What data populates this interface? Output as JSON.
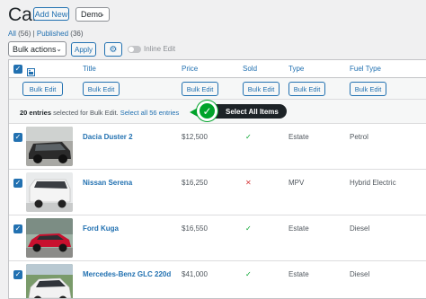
{
  "header": {
    "title": "Cars",
    "add_new": "Add New",
    "view_select": "Demo"
  },
  "subsubsub": {
    "all": "All",
    "all_count": "(56)",
    "sep": "|",
    "published": "Published",
    "published_count": "(36)"
  },
  "toolbar": {
    "bulk_actions": "Bulk actions",
    "apply": "Apply",
    "inline_edit": "Inline Edit"
  },
  "columns": [
    "Title",
    "Price",
    "Sold",
    "Type",
    "Fuel Type"
  ],
  "bulk_edit_label": "Bulk Edit",
  "selection": {
    "count_text": "20 entries",
    "rest_text": " selected for Bulk Edit.",
    "select_all_link": "Select all 56 entries",
    "callout": "Select All Items"
  },
  "rows": [
    {
      "title": "Dacia Duster 2",
      "price": "$12,500",
      "sold": "✓",
      "sold_state": "yes",
      "type": "Estate",
      "fuel": "Petrol",
      "car_color": "#2b2b2b"
    },
    {
      "title": "Nissan Serena",
      "price": "$16,250",
      "sold": "✕",
      "sold_state": "no",
      "type": "MPV",
      "fuel": "Hybrid Electric",
      "car_color": "#eeeeee"
    },
    {
      "title": "Ford Kuga",
      "price": "$16,550",
      "sold": "✓",
      "sold_state": "yes",
      "type": "Estate",
      "fuel": "Diesel",
      "car_color": "#c8102e"
    },
    {
      "title": "Mercedes-Benz GLC 220d",
      "price": "$41,000",
      "sold": "✓",
      "sold_state": "yes",
      "type": "Estate",
      "fuel": "Diesel",
      "car_color": "#f2f2f2"
    }
  ]
}
